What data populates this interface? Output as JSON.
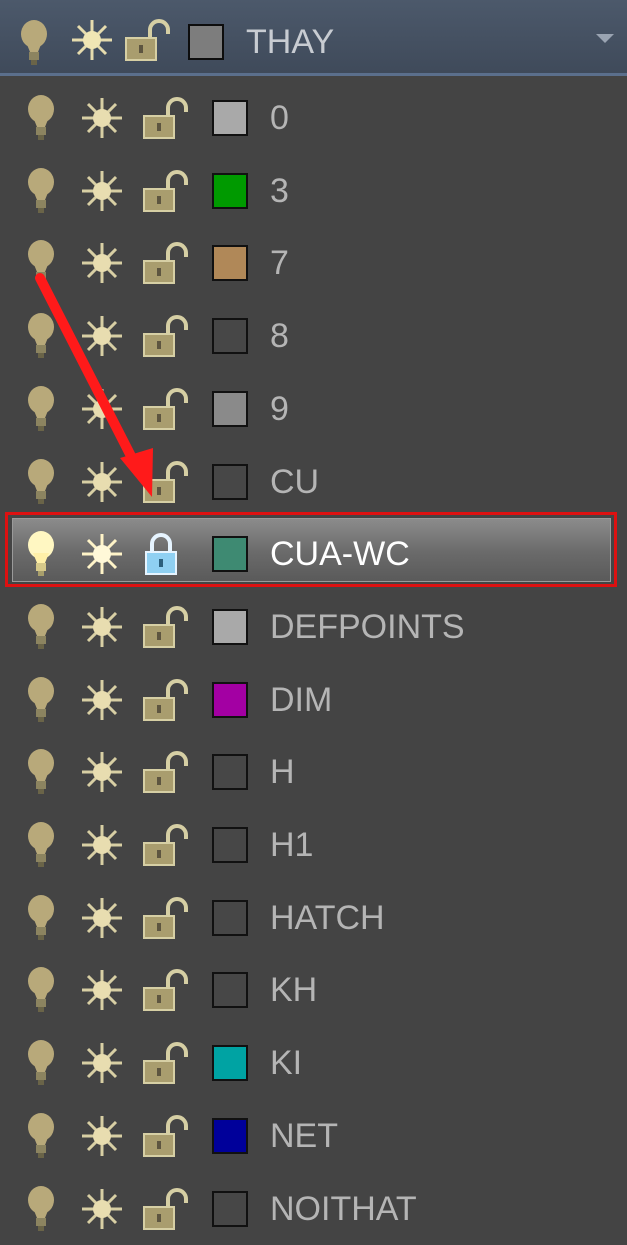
{
  "dropdown": {
    "current_layer": "THAY",
    "current_color": "#7d7d7d"
  },
  "layers": [
    {
      "name": "0",
      "color": "#a9a9a9"
    },
    {
      "name": "3",
      "color": "#009a00"
    },
    {
      "name": "7",
      "color": "#b08858"
    },
    {
      "name": "8",
      "color": "#474747"
    },
    {
      "name": "9",
      "color": "#8a8a8a"
    },
    {
      "name": "CU",
      "color": "#474747"
    },
    {
      "name": "CUA-WC",
      "color": "#3e8a72",
      "selected": true,
      "locked": true
    },
    {
      "name": "DEFPOINTS",
      "color": "#a9a9a9"
    },
    {
      "name": "DIM",
      "color": "#a300a3"
    },
    {
      "name": "H",
      "color": "#474747"
    },
    {
      "name": "H1",
      "color": "#474747"
    },
    {
      "name": "HATCH",
      "color": "#474747"
    },
    {
      "name": "KH",
      "color": "#474747"
    },
    {
      "name": "KI",
      "color": "#00a3a3"
    },
    {
      "name": "NET",
      "color": "#00009a"
    },
    {
      "name": "NOITHAT",
      "color": "#474747"
    }
  ],
  "icons": {
    "on": "lightbulb-icon",
    "freeze": "sun-icon",
    "lock": "padlock-icon"
  },
  "annotation": {
    "arrow_color": "#ff1a1a",
    "highlight_color": "#dd1111"
  }
}
